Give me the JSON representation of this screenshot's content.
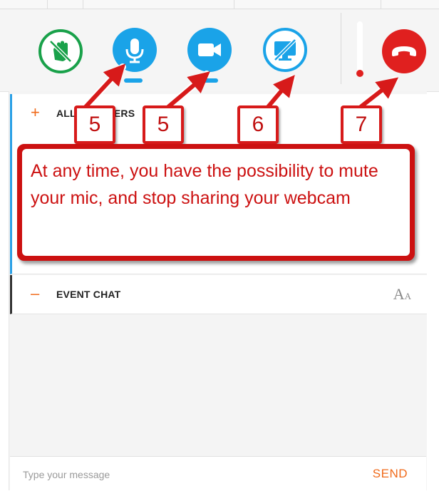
{
  "toolbar": {
    "controls": [
      {
        "name": "raise-hand",
        "icon": "raise-hand-icon",
        "color": "#19a14a"
      },
      {
        "name": "microphone",
        "icon": "microphone-icon",
        "color": "#1aa3e8"
      },
      {
        "name": "webcam",
        "icon": "video-camera-icon",
        "color": "#1aa3e8"
      },
      {
        "name": "screen-share",
        "icon": "screen-share-off-icon",
        "color": "#1aa3e8"
      },
      {
        "name": "hang-up",
        "icon": "phone-hangup-icon",
        "color": "#e0201f"
      }
    ]
  },
  "panel": {
    "speakers_title": "ALL SPEAKERS",
    "speakers_sign": "+",
    "chat_title": "EVENT CHAT",
    "chat_sign": "–",
    "font_size_big": "A",
    "font_size_small": "A"
  },
  "chat_input": {
    "placeholder": "Type your message",
    "send_label": "SEND"
  },
  "annotation": {
    "badges": [
      "5",
      "5",
      "6",
      "7"
    ],
    "callout_text": "At any time, you have the possibility to mute your mic, and stop sharing your webcam",
    "color": "#cc1111"
  }
}
